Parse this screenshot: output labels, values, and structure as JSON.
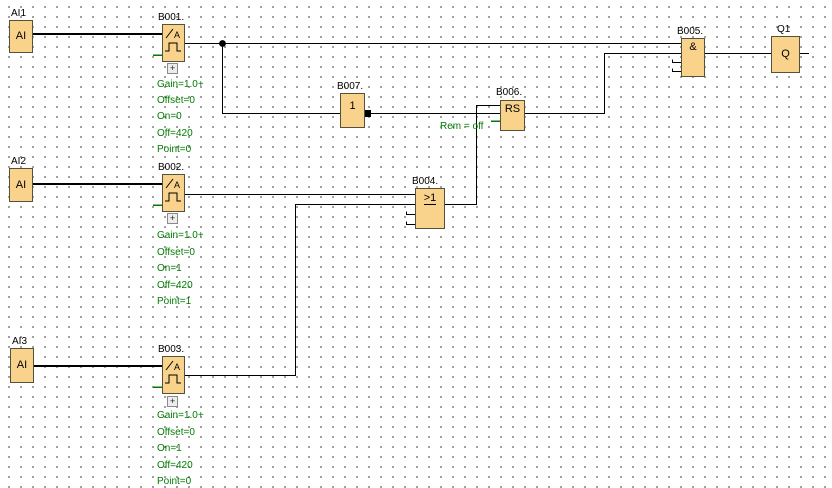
{
  "app": "function-block-diagram-editor",
  "colors": {
    "block_fill": "#F9D28C",
    "block_border": "#54523A",
    "param_text": "#007B00",
    "wire": "#000000",
    "grid_dot": "#3C3C3C",
    "background": "#FFFFFF"
  },
  "trigger_symbol_letter": "A",
  "expand_icon_label": "+",
  "blocks": {
    "ai1": {
      "label": "AI1",
      "symbol": "AI"
    },
    "ai2": {
      "label": "AI2",
      "symbol": "AI"
    },
    "ai3": {
      "label": "AI3",
      "symbol": "AI"
    },
    "b001": {
      "label": "B001.",
      "params": [
        "Gain=1.0+",
        "Offset=0",
        "On=0",
        "Off=420",
        "Point=0"
      ]
    },
    "b002": {
      "label": "B002.",
      "params": [
        "Gain=1.0+",
        "Offset=0",
        "On=1",
        "Off=420",
        "Point=1"
      ]
    },
    "b003": {
      "label": "B003.",
      "params": [
        "Gain=1.0+",
        "Offset=0",
        "On=1",
        "Off=420",
        "Point=0"
      ]
    },
    "b004": {
      "label": "B004.",
      "symbol": ">1"
    },
    "b005": {
      "label": "B005.",
      "symbol": "&"
    },
    "b006": {
      "label": "B006.",
      "symbol": "RS",
      "param": "Rem = off"
    },
    "b007": {
      "label": "B007.",
      "symbol": "1"
    },
    "q1": {
      "label": "Q1",
      "symbol": "Q"
    }
  }
}
